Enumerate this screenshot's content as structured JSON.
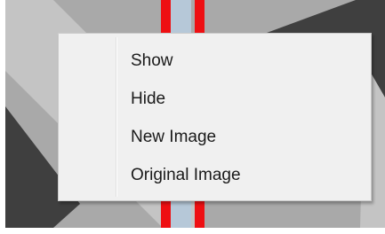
{
  "colors": {
    "background_gray": "#a9a9a9",
    "dark_gray": "#3f3f3f",
    "light_gray": "#c4c4c4",
    "stripe_red": "#ee0f12",
    "stripe_blue": "#b6c8d8",
    "menu_bg": "#f0f0f0",
    "menu_border": "#cbcbcb"
  },
  "context_menu": {
    "items": [
      {
        "label": "Show"
      },
      {
        "label": "Hide"
      },
      {
        "label": "New Image"
      },
      {
        "label": "Original Image"
      }
    ]
  }
}
